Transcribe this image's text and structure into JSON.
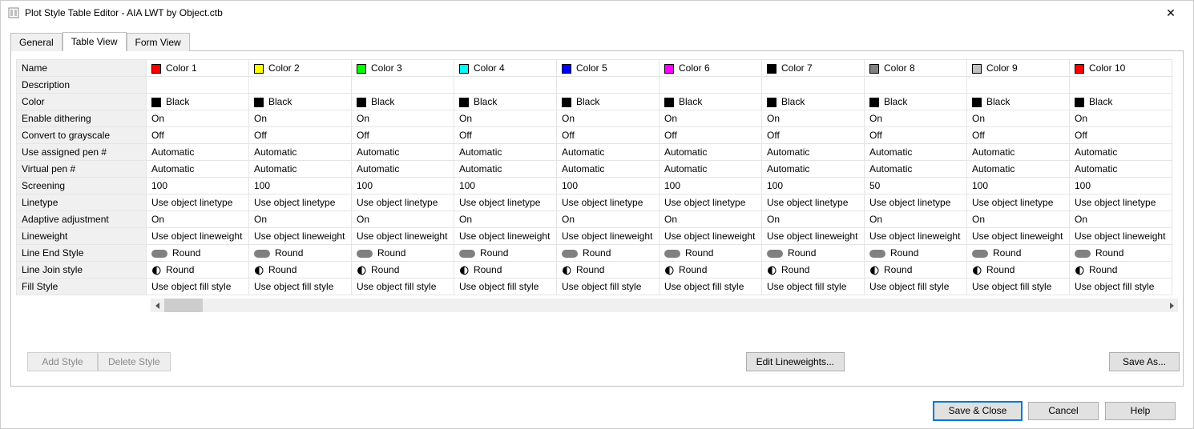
{
  "window": {
    "title": "Plot Style Table Editor - AIA LWT by Object.ctb"
  },
  "tabs": {
    "general": "General",
    "table": "Table View",
    "form": "Form View"
  },
  "properties": {
    "name": "Name",
    "description": "Description",
    "color": "Color",
    "dithering": "Enable dithering",
    "grayscale": "Convert to grayscale",
    "assigned_pen": "Use assigned pen #",
    "virtual_pen": "Virtual pen #",
    "screening": "Screening",
    "linetype": "Linetype",
    "adaptive": "Adaptive adjustment",
    "lineweight": "Lineweight",
    "end_style": "Line End Style",
    "join_style": "Line Join style",
    "fill_style": "Fill Style"
  },
  "col_swatches": [
    "#ff0000",
    "#ffff00",
    "#00ff00",
    "#00ffff",
    "#0000ff",
    "#ff00ff",
    "#000000",
    "#808080",
    "#c0c0c0",
    "#ff0000"
  ],
  "columns": [
    {
      "name": "Color 1",
      "description": "",
      "color": "Black",
      "dithering": "On",
      "grayscale": "Off",
      "assigned_pen": "Automatic",
      "virtual_pen": "Automatic",
      "screening": "100",
      "linetype": "Use object linetype",
      "adaptive": "On",
      "lineweight": "Use object lineweight",
      "end_style": "Round",
      "join_style": "Round",
      "fill_style": "Use object fill style"
    },
    {
      "name": "Color 2",
      "description": "",
      "color": "Black",
      "dithering": "On",
      "grayscale": "Off",
      "assigned_pen": "Automatic",
      "virtual_pen": "Automatic",
      "screening": "100",
      "linetype": "Use object linetype",
      "adaptive": "On",
      "lineweight": "Use object lineweight",
      "end_style": "Round",
      "join_style": "Round",
      "fill_style": "Use object fill style"
    },
    {
      "name": "Color 3",
      "description": "",
      "color": "Black",
      "dithering": "On",
      "grayscale": "Off",
      "assigned_pen": "Automatic",
      "virtual_pen": "Automatic",
      "screening": "100",
      "linetype": "Use object linetype",
      "adaptive": "On",
      "lineweight": "Use object lineweight",
      "end_style": "Round",
      "join_style": "Round",
      "fill_style": "Use object fill style"
    },
    {
      "name": "Color 4",
      "description": "",
      "color": "Black",
      "dithering": "On",
      "grayscale": "Off",
      "assigned_pen": "Automatic",
      "virtual_pen": "Automatic",
      "screening": "100",
      "linetype": "Use object linetype",
      "adaptive": "On",
      "lineweight": "Use object lineweight",
      "end_style": "Round",
      "join_style": "Round",
      "fill_style": "Use object fill style"
    },
    {
      "name": "Color 5",
      "description": "",
      "color": "Black",
      "dithering": "On",
      "grayscale": "Off",
      "assigned_pen": "Automatic",
      "virtual_pen": "Automatic",
      "screening": "100",
      "linetype": "Use object linetype",
      "adaptive": "On",
      "lineweight": "Use object lineweight",
      "end_style": "Round",
      "join_style": "Round",
      "fill_style": "Use object fill style"
    },
    {
      "name": "Color 6",
      "description": "",
      "color": "Black",
      "dithering": "On",
      "grayscale": "Off",
      "assigned_pen": "Automatic",
      "virtual_pen": "Automatic",
      "screening": "100",
      "linetype": "Use object linetype",
      "adaptive": "On",
      "lineweight": "Use object lineweight",
      "end_style": "Round",
      "join_style": "Round",
      "fill_style": "Use object fill style"
    },
    {
      "name": "Color 7",
      "description": "",
      "color": "Black",
      "dithering": "On",
      "grayscale": "Off",
      "assigned_pen": "Automatic",
      "virtual_pen": "Automatic",
      "screening": "100",
      "linetype": "Use object linetype",
      "adaptive": "On",
      "lineweight": "Use object lineweight",
      "end_style": "Round",
      "join_style": "Round",
      "fill_style": "Use object fill style"
    },
    {
      "name": "Color 8",
      "description": "",
      "color": "Black",
      "dithering": "On",
      "grayscale": "Off",
      "assigned_pen": "Automatic",
      "virtual_pen": "Automatic",
      "screening": "50",
      "linetype": "Use object linetype",
      "adaptive": "On",
      "lineweight": "Use object lineweight",
      "end_style": "Round",
      "join_style": "Round",
      "fill_style": "Use object fill style"
    },
    {
      "name": "Color 9",
      "description": "",
      "color": "Black",
      "dithering": "On",
      "grayscale": "Off",
      "assigned_pen": "Automatic",
      "virtual_pen": "Automatic",
      "screening": "100",
      "linetype": "Use object linetype",
      "adaptive": "On",
      "lineweight": "Use object lineweight",
      "end_style": "Round",
      "join_style": "Round",
      "fill_style": "Use object fill style"
    },
    {
      "name": "Color 10",
      "description": "",
      "color": "Black",
      "dithering": "On",
      "grayscale": "Off",
      "assigned_pen": "Automatic",
      "virtual_pen": "Automatic",
      "screening": "100",
      "linetype": "Use object linetype",
      "adaptive": "On",
      "lineweight": "Use object lineweight",
      "end_style": "Round",
      "join_style": "Round",
      "fill_style": "Use object fill style"
    }
  ],
  "buttons": {
    "add_style": "Add Style",
    "delete_style": "Delete Style",
    "edit_lineweights": "Edit Lineweights...",
    "save_as": "Save As...",
    "save_close": "Save & Close",
    "cancel": "Cancel",
    "help": "Help"
  }
}
